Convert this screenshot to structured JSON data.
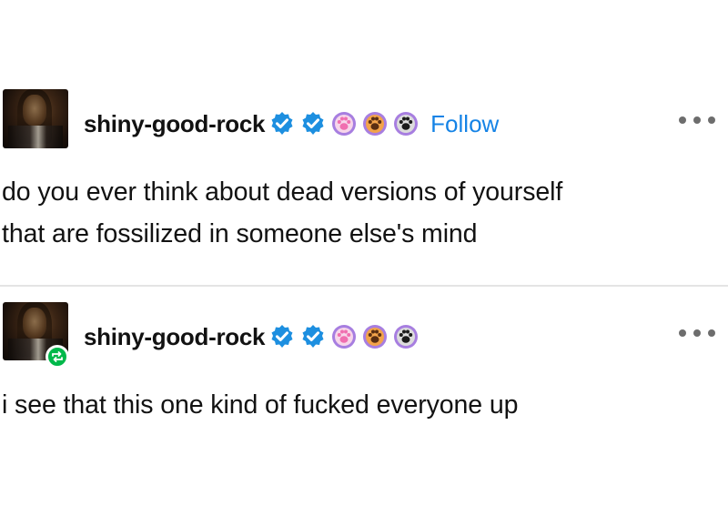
{
  "posts": [
    {
      "blog_name": "shiny-good-rock",
      "follow_label": "Follow",
      "badge_icons": [
        "verified-checkmark-icon",
        "verified-checkmark-icon",
        "pink-paw-icon",
        "brown-paw-icon",
        "black-paw-icon"
      ],
      "body_lines": [
        "do you ever think about dead versions of yourself",
        "that are fossilized in someone else's mind"
      ],
      "is_reblog": false
    },
    {
      "blog_name": "shiny-good-rock",
      "badge_icons": [
        "verified-checkmark-icon",
        "verified-checkmark-icon",
        "pink-paw-icon",
        "brown-paw-icon",
        "black-paw-icon"
      ],
      "body_lines": [
        "i see that this one kind of fucked everyone up"
      ],
      "is_reblog": true
    }
  ],
  "colors": {
    "follow_link": "#1583e6",
    "verified_badge": "#1d8fe0",
    "reblog_badge": "#00b84a",
    "paw_ring": "#a77ee0"
  }
}
